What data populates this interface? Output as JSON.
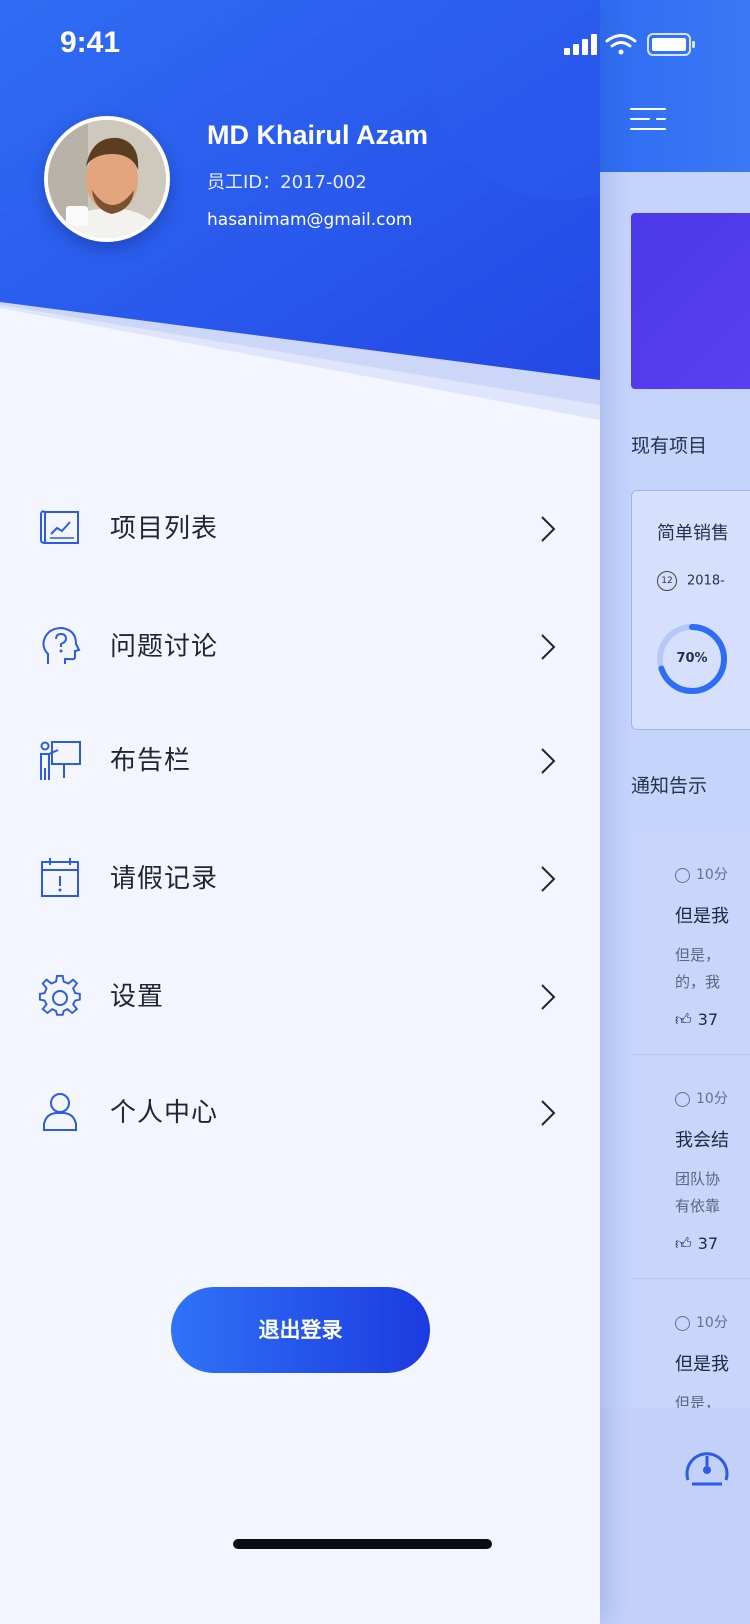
{
  "status_bar": {
    "time": "9:41"
  },
  "profile": {
    "name": "MD Khairul Azam",
    "employee_id": "员工ID：2017-002",
    "email": "hasanimam@gmail.com"
  },
  "menu": [
    {
      "label": "项目列表",
      "icon": "blueprint-chart-icon"
    },
    {
      "label": "问题讨论",
      "icon": "head-question-icon"
    },
    {
      "label": "布告栏",
      "icon": "presentation-board-icon"
    },
    {
      "label": "请假记录",
      "icon": "calendar-alert-icon"
    },
    {
      "label": "设置",
      "icon": "gear-icon"
    },
    {
      "label": "个人中心",
      "icon": "user-icon"
    }
  ],
  "logout_label": "退出登录",
  "background_page": {
    "section_projects": "现有项目",
    "project_card": {
      "title": "简单销售",
      "date": "2018-",
      "progress_label": "70%",
      "progress": 0.7
    },
    "section_notices": "通知告示",
    "feed": [
      {
        "time": "10分",
        "title": "但是我",
        "body_line1": "但是，",
        "body_line2": "的，我",
        "likes": "37"
      },
      {
        "time": "10分",
        "title": "我会结",
        "body_line1": "团队协",
        "body_line2": "有依靠",
        "likes": "37"
      },
      {
        "time": "10分",
        "title": "但是我",
        "body_line1": "但是，",
        "body_line2": "",
        "likes": ""
      }
    ]
  },
  "colors": {
    "primary": "#2f6df3",
    "primary_dark": "#1c3ae0",
    "drawer_bg": "#f3f6fe",
    "icon_blue": "#2d5be3"
  }
}
